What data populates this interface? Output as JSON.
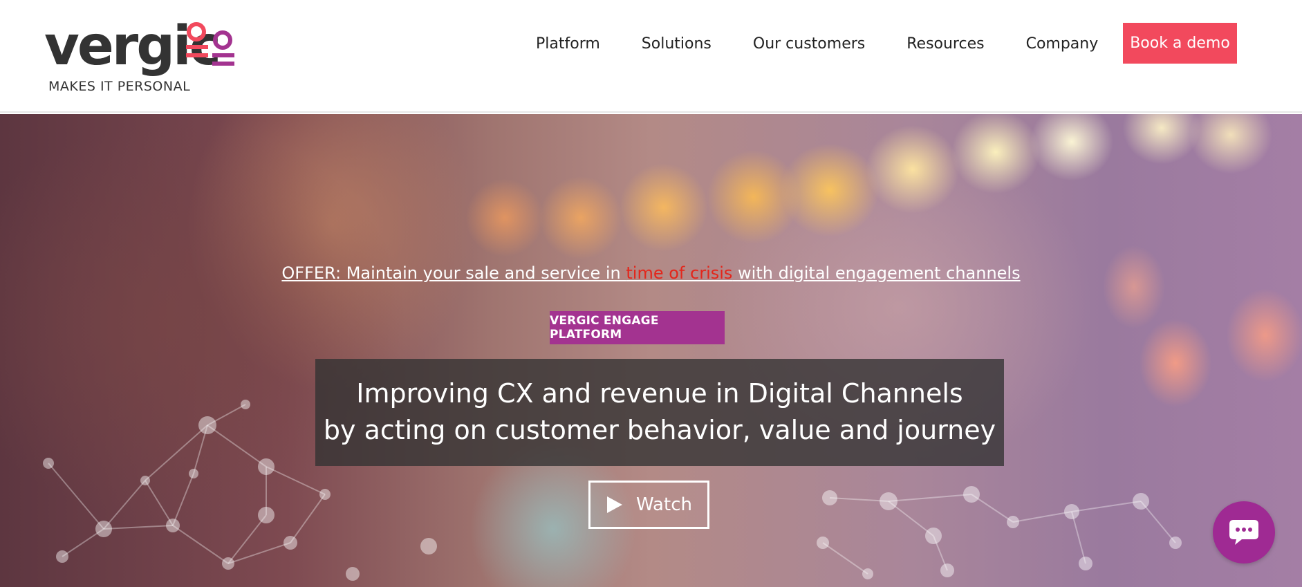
{
  "brand": {
    "name": "vergic",
    "tagline": "MAKES IT PERSONAL",
    "accent_pink": "#f2495d",
    "accent_purple": "#a33390",
    "logo_mark_colors": [
      "#f2495d",
      "#a33390"
    ]
  },
  "nav": {
    "items": [
      {
        "label": "Platform"
      },
      {
        "label": "Solutions"
      },
      {
        "label": "Our customers"
      },
      {
        "label": "Resources"
      },
      {
        "label": "Company"
      }
    ],
    "cta_label": "Book a demo"
  },
  "hero": {
    "offer": {
      "before": "OFFER: Maintain your sale and service in ",
      "highlight": "time of crisis",
      "after": " with digital engagement channels",
      "highlight_color": "#e3261b"
    },
    "badge": "VERGIC ENGAGE PLATFORM",
    "headline_line1": "Improving CX and revenue in Digital Channels",
    "headline_line2": "by acting on customer behavior, value and journey",
    "watch_label": "Watch",
    "watch_icon": "play-icon"
  },
  "chat": {
    "icon": "chat-bubble-icon"
  }
}
